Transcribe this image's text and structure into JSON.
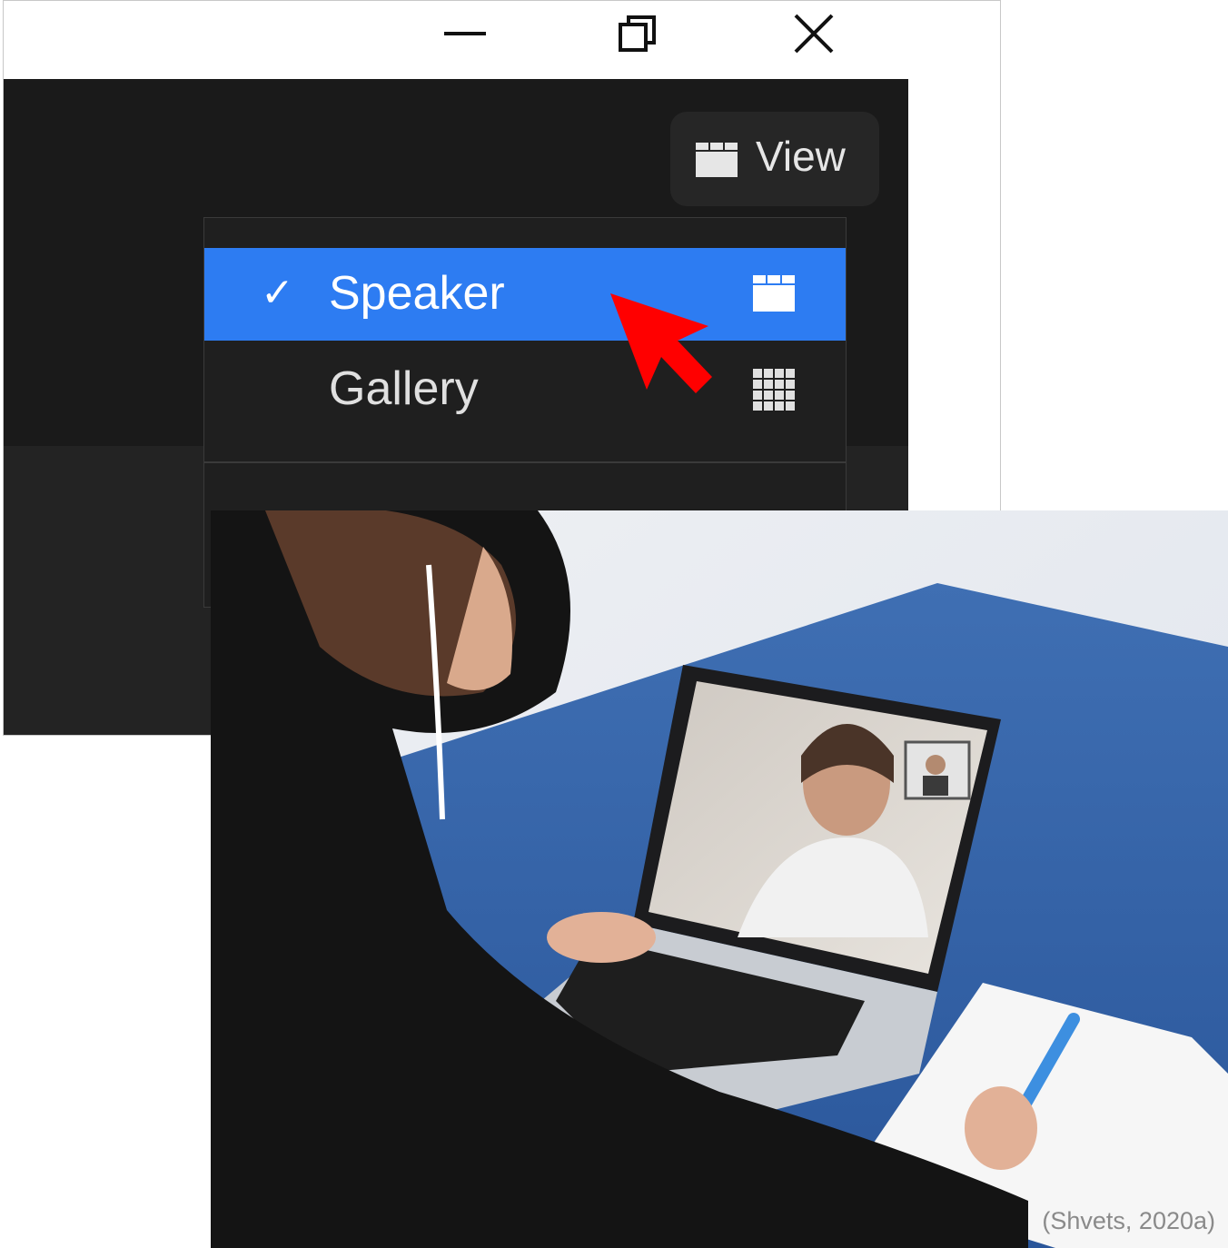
{
  "window_controls": {
    "minimize": "minimize-icon",
    "maximize": "restore-icon",
    "close": "close-icon"
  },
  "toolbar": {
    "view_label": "View",
    "view_icon": "speaker-view-icon"
  },
  "view_menu": {
    "items": [
      {
        "label": "Speaker",
        "selected": true,
        "check": "✓",
        "icon": "speaker-view-icon"
      },
      {
        "label": "Gallery",
        "selected": false,
        "icon": "gallery-grid-icon"
      }
    ],
    "highlight_color": "#2d7cf2"
  },
  "annotation": {
    "icon": "red-cursor-arrow",
    "color": "#ff0000"
  },
  "photo": {
    "credit": "(Shvets, 2020a)"
  }
}
